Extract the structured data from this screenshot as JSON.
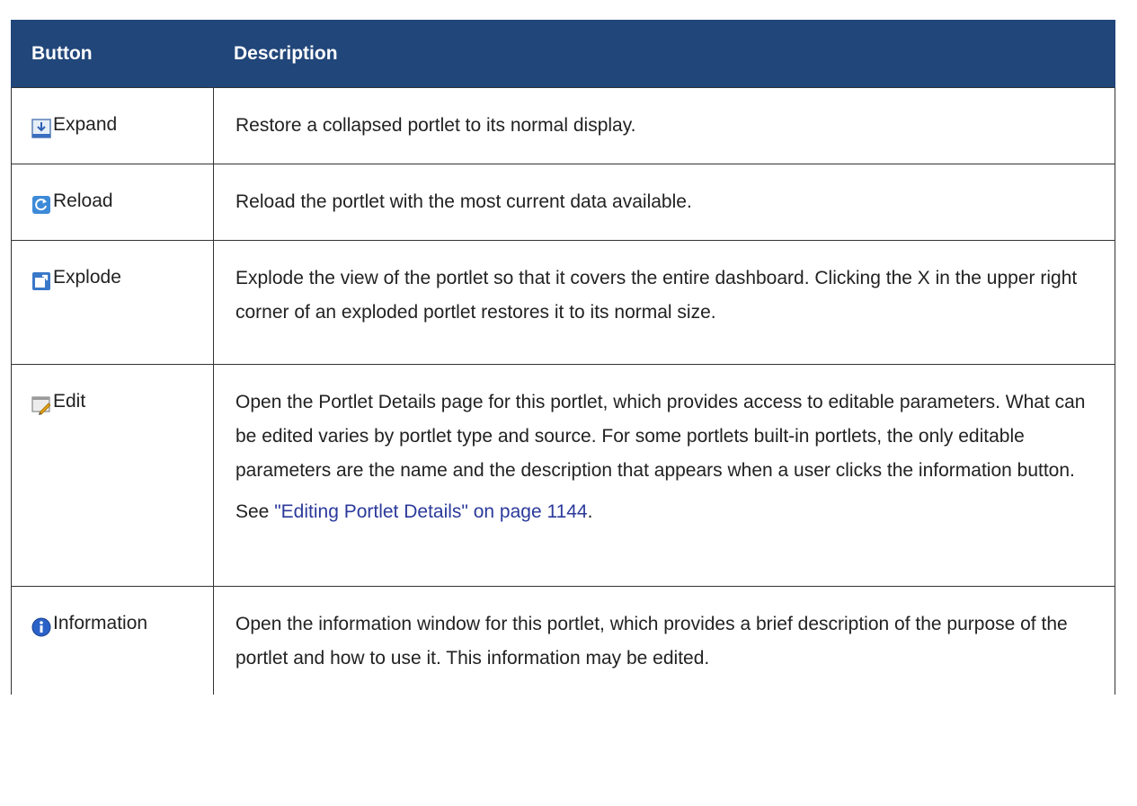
{
  "table": {
    "headers": {
      "button": "Button",
      "description": "Description"
    },
    "rows": [
      {
        "icon": "expand-icon",
        "label": "Expand",
        "description": "Restore a collapsed portlet to its normal display."
      },
      {
        "icon": "reload-icon",
        "label": "Reload",
        "description": "Reload the portlet with the most current data available."
      },
      {
        "icon": "explode-icon",
        "label": "Explode",
        "description": "Explode the view of the portlet so that it covers the entire dashboard. Clicking the X in the upper right corner of an exploded portlet restores it to its normal size."
      },
      {
        "icon": "edit-icon",
        "label": "Edit",
        "description": "Open the Portlet Details page for this portlet, which provides access to editable parameters. What can be edited varies by portlet type and source. For some portlets built-in portlets, the only editable parameters are the name and the description that appears when a user clicks the information button.",
        "see_prefix": "See ",
        "see_link": "\"Editing Portlet Details\" on page 1144",
        "see_suffix": "."
      },
      {
        "icon": "information-icon",
        "label": "Information",
        "description": "Open the information window for this portlet, which provides a brief description of the purpose of the portlet and how to use it. This information may be edited."
      }
    ]
  },
  "colors": {
    "header_bg": "#21467a",
    "header_text": "#ffffff",
    "link": "#2b3a9b",
    "border": "#333333"
  }
}
